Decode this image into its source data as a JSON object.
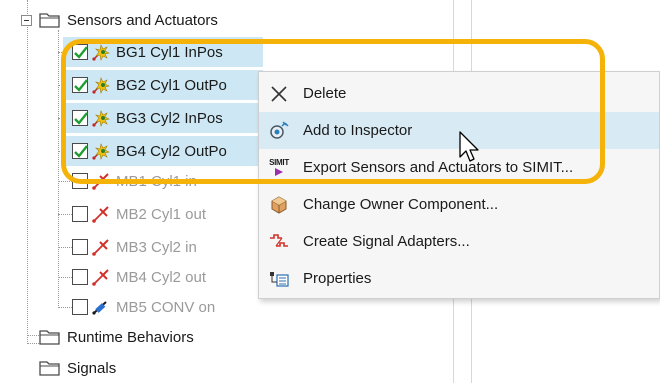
{
  "tree": {
    "folders": [
      {
        "label": "Sensors and Actuators"
      },
      {
        "label": "Runtime Behaviors"
      },
      {
        "label": "Signals"
      }
    ],
    "signals": [
      {
        "label": "BG1 Cyl1 InPos",
        "checked": true,
        "kind": "sensor",
        "selected": true
      },
      {
        "label": "BG2 Cyl1 OutPo",
        "checked": true,
        "kind": "sensor",
        "selected": true
      },
      {
        "label": "BG3 Cyl2 InPos",
        "checked": true,
        "kind": "sensor",
        "selected": true
      },
      {
        "label": "BG4 Cyl2 OutPo",
        "checked": true,
        "kind": "sensor",
        "selected": true
      },
      {
        "label": "MB1 Cyl1 in",
        "checked": false,
        "kind": "actuator",
        "selected": false
      },
      {
        "label": "MB2 Cyl1 out",
        "checked": false,
        "kind": "actuator",
        "selected": false
      },
      {
        "label": "MB3 Cyl2 in",
        "checked": false,
        "kind": "actuator",
        "selected": false
      },
      {
        "label": "MB4 Cyl2 out",
        "checked": false,
        "kind": "actuator",
        "selected": false
      },
      {
        "label": "MB5 CONV on",
        "checked": false,
        "kind": "conveyor",
        "selected": false
      }
    ]
  },
  "context_menu": {
    "items": [
      {
        "label": "Delete",
        "icon": "close-icon"
      },
      {
        "label": "Add to Inspector",
        "icon": "inspector-icon"
      },
      {
        "label": "Export Sensors and Actuators to SIMIT...",
        "icon": "simit-export-icon",
        "icon_text": "SIMIT"
      },
      {
        "label": "Change Owner Component...",
        "icon": "component-icon"
      },
      {
        "label": "Create Signal Adapters...",
        "icon": "signal-adapter-icon"
      },
      {
        "label": "Properties",
        "icon": "properties-icon"
      }
    ],
    "hovered_index": 1
  },
  "colors": {
    "selection": "#cde8f4",
    "menu_hover": "#d8eaf4",
    "highlight_ring": "#f5b30a",
    "check_green": "#1e9e2f"
  }
}
